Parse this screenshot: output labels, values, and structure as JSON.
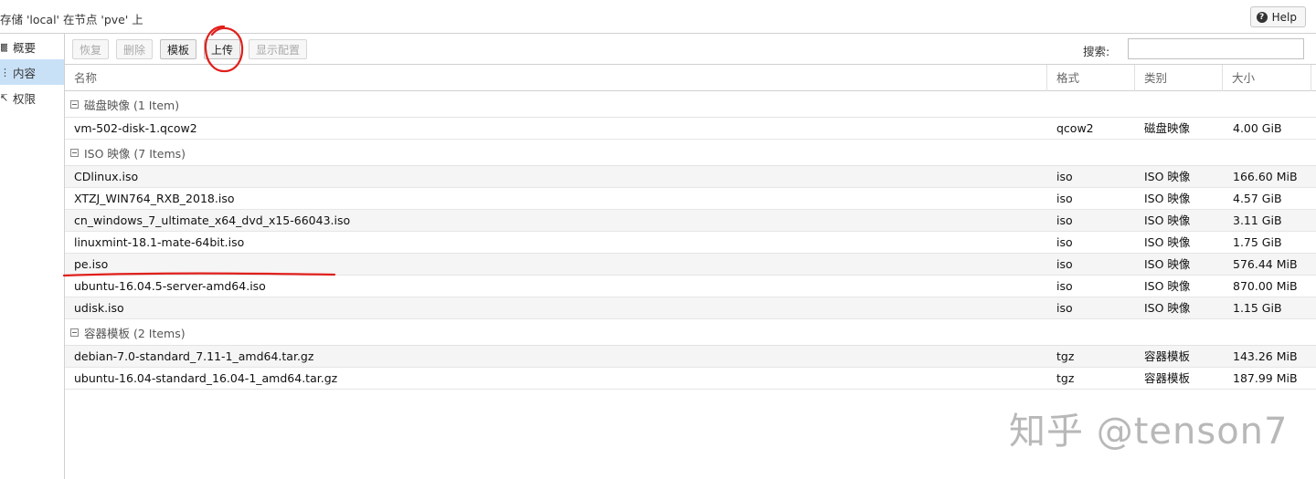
{
  "window": {
    "title": "存储 'local' 在节点 'pve' 上",
    "help_label": "Help",
    "help_icon": "question-circle-icon"
  },
  "sidebar": {
    "items": [
      {
        "label": "概要",
        "icon": "book-icon",
        "active": false
      },
      {
        "label": "内容",
        "icon": "grid-icon",
        "active": true
      },
      {
        "label": "权限",
        "icon": "unlock-icon",
        "active": false
      }
    ]
  },
  "toolbar": {
    "restore": "恢复",
    "remove": "删除",
    "templates": "模板",
    "upload": "上传",
    "show_config": "显示配置",
    "search_label": "搜索:",
    "search_value": ""
  },
  "grid": {
    "columns": {
      "name": "名称",
      "format": "格式",
      "type": "类别",
      "size": "大小"
    },
    "groups": [
      {
        "label": "磁盘映像 (1 Item)",
        "rows": [
          {
            "name": "vm-502-disk-1.qcow2",
            "format": "qcow2",
            "type": "磁盘映像",
            "size": "4.00 GiB"
          }
        ]
      },
      {
        "label": "ISO 映像 (7 Items)",
        "rows": [
          {
            "name": "CDlinux.iso",
            "format": "iso",
            "type": "ISO 映像",
            "size": "166.60 MiB"
          },
          {
            "name": "XTZJ_WIN764_RXB_2018.iso",
            "format": "iso",
            "type": "ISO 映像",
            "size": "4.57 GiB"
          },
          {
            "name": "cn_windows_7_ultimate_x64_dvd_x15-66043.iso",
            "format": "iso",
            "type": "ISO 映像",
            "size": "3.11 GiB"
          },
          {
            "name": "linuxmint-18.1-mate-64bit.iso",
            "format": "iso",
            "type": "ISO 映像",
            "size": "1.75 GiB"
          },
          {
            "name": "pe.iso",
            "format": "iso",
            "type": "ISO 映像",
            "size": "576.44 MiB"
          },
          {
            "name": "ubuntu-16.04.5-server-amd64.iso",
            "format": "iso",
            "type": "ISO 映像",
            "size": "870.00 MiB"
          },
          {
            "name": "udisk.iso",
            "format": "iso",
            "type": "ISO 映像",
            "size": "1.15 GiB"
          }
        ]
      },
      {
        "label": "容器模板 (2 Items)",
        "rows": [
          {
            "name": "debian-7.0-standard_7.11-1_amd64.tar.gz",
            "format": "tgz",
            "type": "容器模板",
            "size": "143.26 MiB"
          },
          {
            "name": "ubuntu-16.04-standard_16.04-1_amd64.tar.gz",
            "format": "tgz",
            "type": "容器模板",
            "size": "187.99 MiB"
          }
        ]
      }
    ]
  },
  "watermark": "知乎 @tenson7",
  "colors": {
    "sidebar_active": "#c9e1f7",
    "annotation_red": "#e0201c",
    "alt_row": "#f5f5f5"
  }
}
